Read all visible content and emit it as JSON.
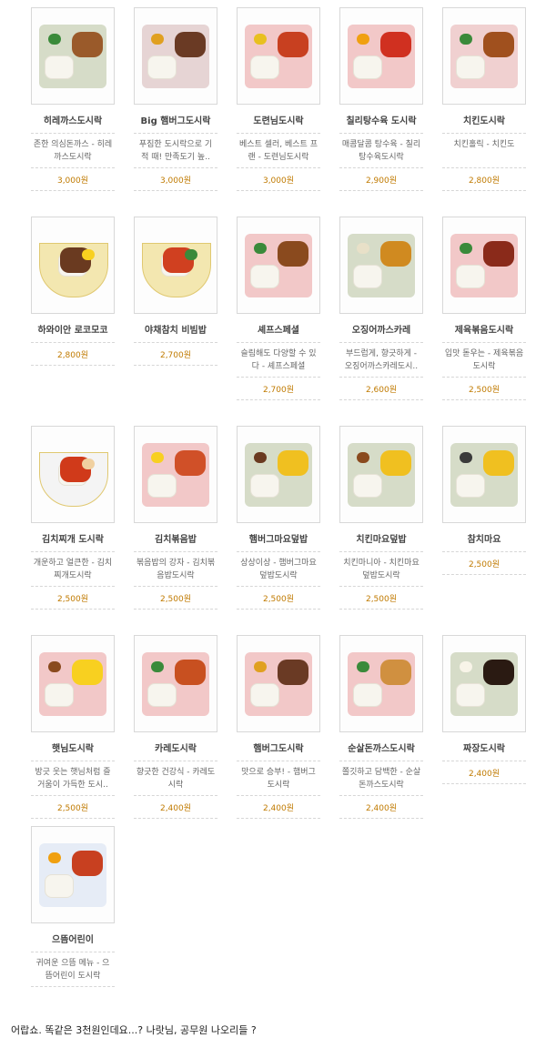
{
  "menu": {
    "items": [
      {
        "name": "히레까스도시락",
        "desc": "존한 의심돈까스 - 히레까스도시락",
        "price": "3,000원",
        "tray": "#d6dcc8",
        "main": "#9a5a2a",
        "side": "#3a8a3a",
        "theme": "tray"
      },
      {
        "name": "Big 햄버그도시락",
        "desc": "푸짐한 도시락으로 기적 때! 만족도기 높..",
        "price": "3,000원",
        "tray": "#e6d4d4",
        "main": "#6a3a24",
        "side": "#e0a020",
        "theme": "tray"
      },
      {
        "name": "도련님도시락",
        "desc": "베스트 셀러, 베스트 프랜 - 도련님도시락",
        "price": "3,000원",
        "tray": "#f2c8c8",
        "main": "#c84020",
        "side": "#e8c020",
        "theme": "tray"
      },
      {
        "name": "칠리탕수육 도시락",
        "desc": "매콤달콤 탕수육 - 칠리탕수육도시락",
        "price": "2,900원",
        "tray": "#f2c8c8",
        "main": "#d03020",
        "side": "#f0a010",
        "theme": "tray"
      },
      {
        "name": "치킨도시락",
        "desc": "치킨홀릭 - 치킨도",
        "price": "2,800원",
        "tray": "#f0d0d0",
        "main": "#a0501e",
        "side": "#3a8a3a",
        "theme": "tray"
      },
      {
        "name": "하와이안 로코모코",
        "desc": "",
        "price": "2,800원",
        "tray": "#f3e7b0",
        "main": "#6a3a20",
        "side": "#f8d020",
        "theme": "bowl"
      },
      {
        "name": "야채참치 비빔밥",
        "desc": "",
        "price": "2,700원",
        "tray": "#f3e7b0",
        "main": "#d04020",
        "side": "#3a8a3a",
        "theme": "bowl"
      },
      {
        "name": "셰프스페셜",
        "desc": "슬림해도 다양할 수 있다 - 셰프스페셜",
        "price": "2,700원",
        "tray": "#f2c8c8",
        "main": "#8a4a1e",
        "side": "#3a8a3a",
        "theme": "tray"
      },
      {
        "name": "오징어까스카레",
        "desc": "부드럽게, 향긋하게 - 오징어까스카레도시..",
        "price": "2,600원",
        "tray": "#d6dcc8",
        "main": "#d08a20",
        "side": "#e8e0c8",
        "theme": "tray"
      },
      {
        "name": "제육볶음도시락",
        "desc": "입맛 돋우는 - 제육볶음도시락",
        "price": "2,500원",
        "tray": "#f2c8c8",
        "main": "#8a2a1a",
        "side": "#3a8a3a",
        "theme": "tray"
      },
      {
        "name": "김치찌개 도시락",
        "desc": "개운하고 얼큰한 - 김치찌개도시락",
        "price": "2,500원",
        "tray": "#f4f4f4",
        "main": "#d03a1a",
        "side": "#f0d0a0",
        "theme": "bowl"
      },
      {
        "name": "김치볶음밥",
        "desc": "볶음밥의 강자 - 김치볶음밥도시락",
        "price": "2,500원",
        "tray": "#f2c8c8",
        "main": "#d05028",
        "side": "#f8d020",
        "theme": "tray"
      },
      {
        "name": "햄버그마요덮밥",
        "desc": "상상이상 - 햄버그마요덮밥도시락",
        "price": "2,500원",
        "tray": "#d6dcc8",
        "main": "#f0c020",
        "side": "#6a3a20",
        "theme": "tray"
      },
      {
        "name": "치킨마요덮밥",
        "desc": "치킨마니아 - 치킨마요덮밥도시락",
        "price": "2,500원",
        "tray": "#d6dcc8",
        "main": "#f0c020",
        "side": "#8a4a1e",
        "theme": "tray"
      },
      {
        "name": "참치마요",
        "desc": "",
        "price": "2,500원",
        "tray": "#d6dcc8",
        "main": "#f0c020",
        "side": "#3a3a3a",
        "theme": "tray"
      },
      {
        "name": "햇님도시락",
        "desc": "방긋 웃는 햇님처럼 즐거움이 가득한 도시..",
        "price": "2,500원",
        "tray": "#f2c8c8",
        "main": "#f8d020",
        "side": "#8a4a1e",
        "theme": "tray"
      },
      {
        "name": "카레도시락",
        "desc": "향긋한 건강식 - 카레도시락",
        "price": "2,400원",
        "tray": "#f2c8c8",
        "main": "#c85020",
        "side": "#3a8a3a",
        "theme": "tray"
      },
      {
        "name": "햄버그도시락",
        "desc": "맛으로 승부! - 햄버그도시락",
        "price": "2,400원",
        "tray": "#f2c8c8",
        "main": "#6a3a24",
        "side": "#e0a020",
        "theme": "tray"
      },
      {
        "name": "순살돈까스도시락",
        "desc": "쫄깃하고 담백한 - 순살돈까스도시락",
        "price": "2,400원",
        "tray": "#f2c8c8",
        "main": "#d09040",
        "side": "#3a8a3a",
        "theme": "tray"
      },
      {
        "name": "짜장도시락",
        "desc": "",
        "price": "2,400원",
        "tray": "#d6dcc8",
        "main": "#2a1a12",
        "side": "#f8f4e8",
        "theme": "tray"
      },
      {
        "name": "으뜸어린이",
        "desc": "귀여운 으뜸 메뉴 - 으뜸어린이 도시락",
        "price": "",
        "tray": "#e6ecf6",
        "main": "#c84020",
        "side": "#f0a010",
        "theme": "tray"
      }
    ]
  },
  "caption": {
    "text": "어랍쇼.   똑같은 3천원인데요...?  나랏님,  공무원 나오리들 ?"
  }
}
